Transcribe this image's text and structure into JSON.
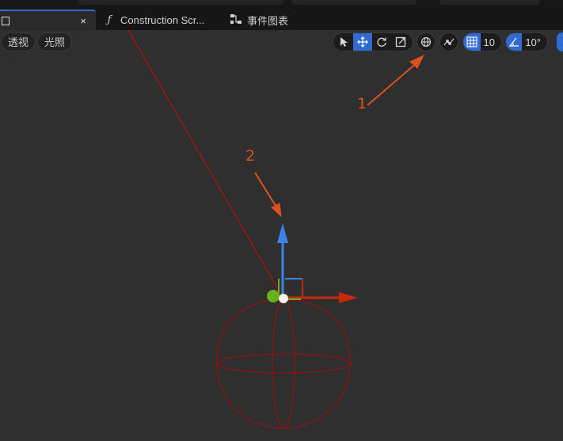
{
  "tabs": [
    {
      "label": "",
      "close": "×"
    },
    {
      "icon": "ƒ",
      "label": "Construction Scr..."
    },
    {
      "label": "事件图表"
    }
  ],
  "toolbar": {
    "perspective": "透视",
    "lighting": "光照",
    "grid_snap": "10",
    "rotation_snap": "10°"
  },
  "annotations": {
    "one": "1",
    "two": "2"
  },
  "colors": {
    "accent": "#2f6bd0",
    "annotation": "#e0501e",
    "wire": "#8c1212"
  },
  "icons": [
    "select-cursor-icon",
    "translate-icon",
    "rotate-icon",
    "scale-icon",
    "world-globe-icon",
    "surface-snap-icon",
    "grid-icon",
    "angle-icon"
  ]
}
